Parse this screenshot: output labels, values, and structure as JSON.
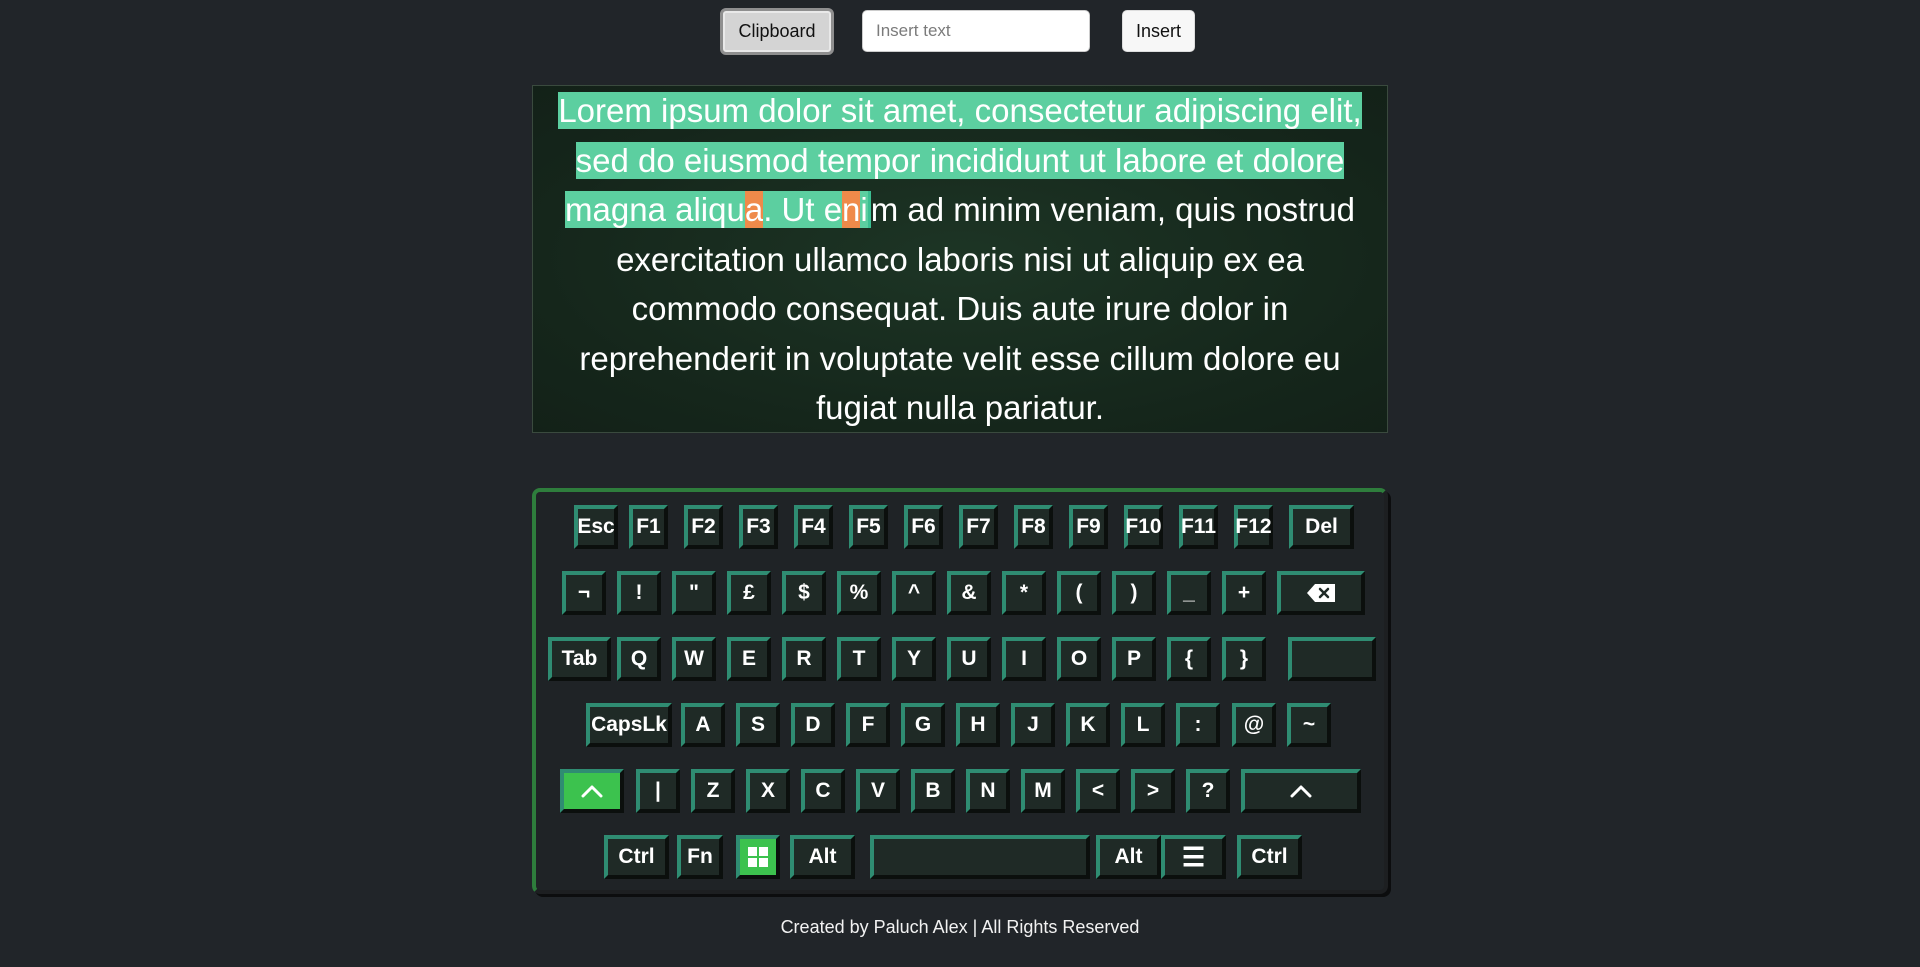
{
  "toolbar": {
    "clipboard_label": "Clipboard",
    "input_placeholder": "Insert text",
    "insert_label": "Insert"
  },
  "text_area": {
    "lines": [
      "Lorem ipsum dolor sit amet, consectetur adipiscing elit,",
      "sed do eiusmod tempor incididunt ut labore et dolore",
      "magna aliqua. Ut enim ad minim veniam, quis nostrud",
      "exercitation ullamco laboris nisi ut aliquip ex ea",
      "commodo consequat. Duis aute irure dolor in",
      "reprehenderit in voluptate velit esse cillum dolore eu",
      "fugiat nulla pariatur."
    ],
    "line3_parts": [
      "magna aliqu",
      "a",
      ". Ut e",
      "n",
      "i",
      "m ad minim veniam, quis nostrud"
    ],
    "colors": {
      "selection": "#5ccfa0",
      "cursor": "#ef8a4a"
    }
  },
  "keyboard": {
    "row1": [
      "Esc",
      "F1",
      "F2",
      "F3",
      "F4",
      "F5",
      "F6",
      "F7",
      "F8",
      "F9",
      "F10",
      "F11",
      "F12",
      "Del"
    ],
    "row2": [
      "¬",
      "!",
      "\"",
      "£",
      "$",
      "%",
      "^",
      "&",
      "*",
      "(",
      ")",
      "_",
      "+",
      "⌫"
    ],
    "row3": [
      "Tab",
      "Q",
      "W",
      "E",
      "R",
      "T",
      "Y",
      "U",
      "I",
      "O",
      "P",
      "{",
      "}",
      ""
    ],
    "row4": [
      "CapsLk",
      "A",
      "S",
      "D",
      "F",
      "G",
      "H",
      "J",
      "K",
      "L",
      ":",
      "@",
      "~"
    ],
    "row5": [
      "^",
      "|",
      "Z",
      "X",
      "C",
      "V",
      "B",
      "N",
      "M",
      "<",
      ">",
      "?",
      "^"
    ],
    "row6": [
      "Ctrl",
      "Fn",
      "win",
      "Alt",
      "",
      "Alt",
      "☰",
      "Ctrl"
    ],
    "active_color": "#3cc24e"
  },
  "footer": {
    "text": "Created by Paluch Alex | All Rights Reserved"
  }
}
